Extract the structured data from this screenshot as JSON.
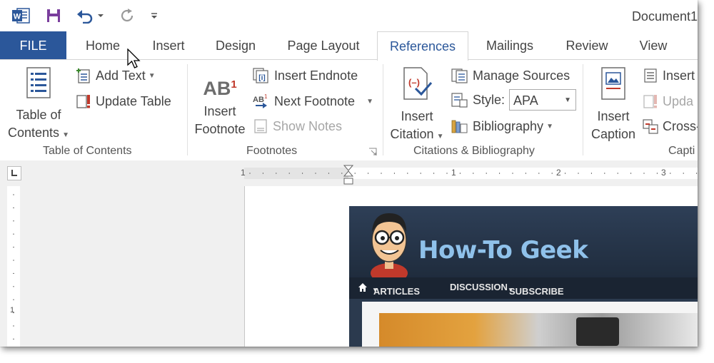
{
  "window": {
    "doc_title": "Document1"
  },
  "quick_access": {
    "icons": [
      "word-logo-icon",
      "save-icon",
      "undo-icon",
      "redo-icon",
      "customize-qat-icon"
    ]
  },
  "tabs": [
    {
      "label": "FILE"
    },
    {
      "label": "Home"
    },
    {
      "label": "Insert"
    },
    {
      "label": "Design"
    },
    {
      "label": "Page Layout"
    },
    {
      "label": "References"
    },
    {
      "label": "Mailings"
    },
    {
      "label": "Review"
    },
    {
      "label": "View"
    }
  ],
  "active_tab": "References",
  "ribbon": {
    "toc_group": {
      "label": "Table of Contents",
      "toc_line1": "Table of",
      "toc_line2": "Contents",
      "add_text": "Add Text",
      "update_table": "Update Table"
    },
    "footnotes_group": {
      "label": "Footnotes",
      "insert_line1": "Insert",
      "insert_line2": "Footnote",
      "ab_glyph": "AB",
      "sup_glyph": "1",
      "insert_endnote": "Insert Endnote",
      "next_footnote": "Next Footnote",
      "show_notes": "Show Notes"
    },
    "citations_group": {
      "label": "Citations & Bibliography",
      "insert_line1": "Insert",
      "insert_line2": "Citation",
      "manage_sources": "Manage Sources",
      "style_label": "Style:",
      "style_value": "APA",
      "bibliography": "Bibliography"
    },
    "captions_group": {
      "label": "Capti",
      "insert_line1": "Insert",
      "insert_line2": "Caption",
      "insert_small": "Insert",
      "update_small": "Upda",
      "cross_small": "Cross-"
    }
  },
  "ruler": {
    "numbers": [
      "1",
      "1",
      "2",
      "3"
    ],
    "vertical_number": "1"
  },
  "document": {
    "site_title": "How-To Geek",
    "nav_items": [
      "ARTICLES",
      "DISCUSSION",
      "SUBSCRIBE"
    ]
  },
  "colors": {
    "accent": "#2b579a",
    "file_tab": "#2b579a",
    "site_title": "#8fc1ea",
    "site_header": "#2e3f57"
  }
}
